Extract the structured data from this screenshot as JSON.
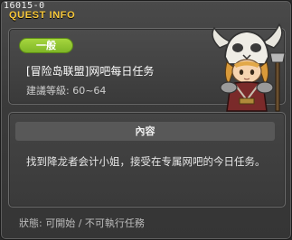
{
  "window": {
    "id_tag": "16015-0",
    "title": "QUEST INFO"
  },
  "quest": {
    "category": "一般",
    "name": "[冒险岛联盟]网吧每日任务",
    "level_text": "建議等級: 60~64",
    "portrait_icon": "skull-helmet-warrior-npc-icon"
  },
  "content": {
    "header": "內容",
    "description": "找到降龙者会计小姐，接受在专属网吧的今日任务。"
  },
  "status": {
    "text": "狀態:  可開始  /  不可執行任務"
  },
  "colors": {
    "title": "#f7c73a",
    "badge": "#8cc430",
    "background": "#3b3b3b"
  }
}
